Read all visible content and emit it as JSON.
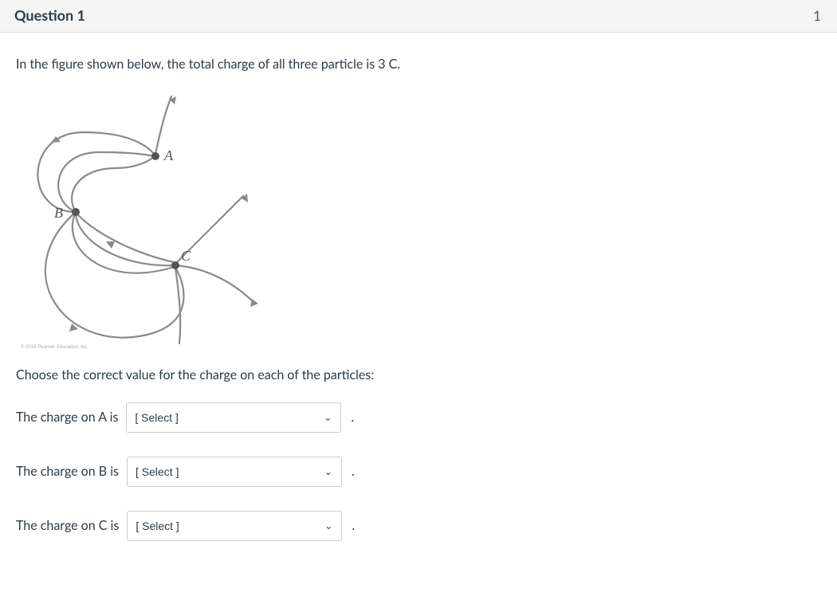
{
  "header": {
    "title": "Question 1",
    "points": "1"
  },
  "prompt": "In the figure shown below, the total charge of all three particle is 3 C.",
  "figure": {
    "labelA": "A",
    "labelB": "B",
    "labelC": "C",
    "copyright": "© 2019 Pearson Education, Inc."
  },
  "instruction": "Choose the correct value for the charge on each of the particles:",
  "rows": [
    {
      "label": "The charge on A is",
      "placeholder": "[ Select ]",
      "suffix": "."
    },
    {
      "label": "The charge on B is",
      "placeholder": "[ Select ]",
      "suffix": "."
    },
    {
      "label": "The charge on C is",
      "placeholder": "[ Select ]",
      "suffix": "."
    }
  ]
}
